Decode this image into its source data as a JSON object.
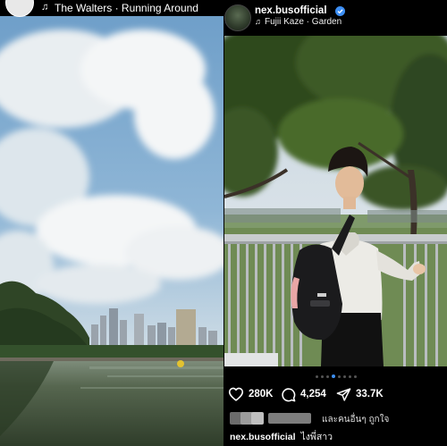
{
  "left_story": {
    "song_label": "The Walters · Running Around"
  },
  "right_post": {
    "username": "nex.busofficial",
    "song_label": "Fujii Kaze · Garden",
    "carousel_pages": 8,
    "active_page": 4,
    "likes": "280K",
    "comments": "4,254",
    "shares": "33.7K",
    "liked_by_text": "และคนอื่นๆ ถูกใจ",
    "caption_user": "nex.busofficial",
    "caption_text": "ไงพี่สาว"
  },
  "icons": {
    "music": "music-note-icon",
    "verified": "verified-badge-icon",
    "like": "heart-icon",
    "comment": "comment-icon",
    "share": "send-icon"
  },
  "colors": {
    "background": "#000000",
    "verified": "#3d8ff5",
    "carousel_active": "#3d8ff5"
  }
}
